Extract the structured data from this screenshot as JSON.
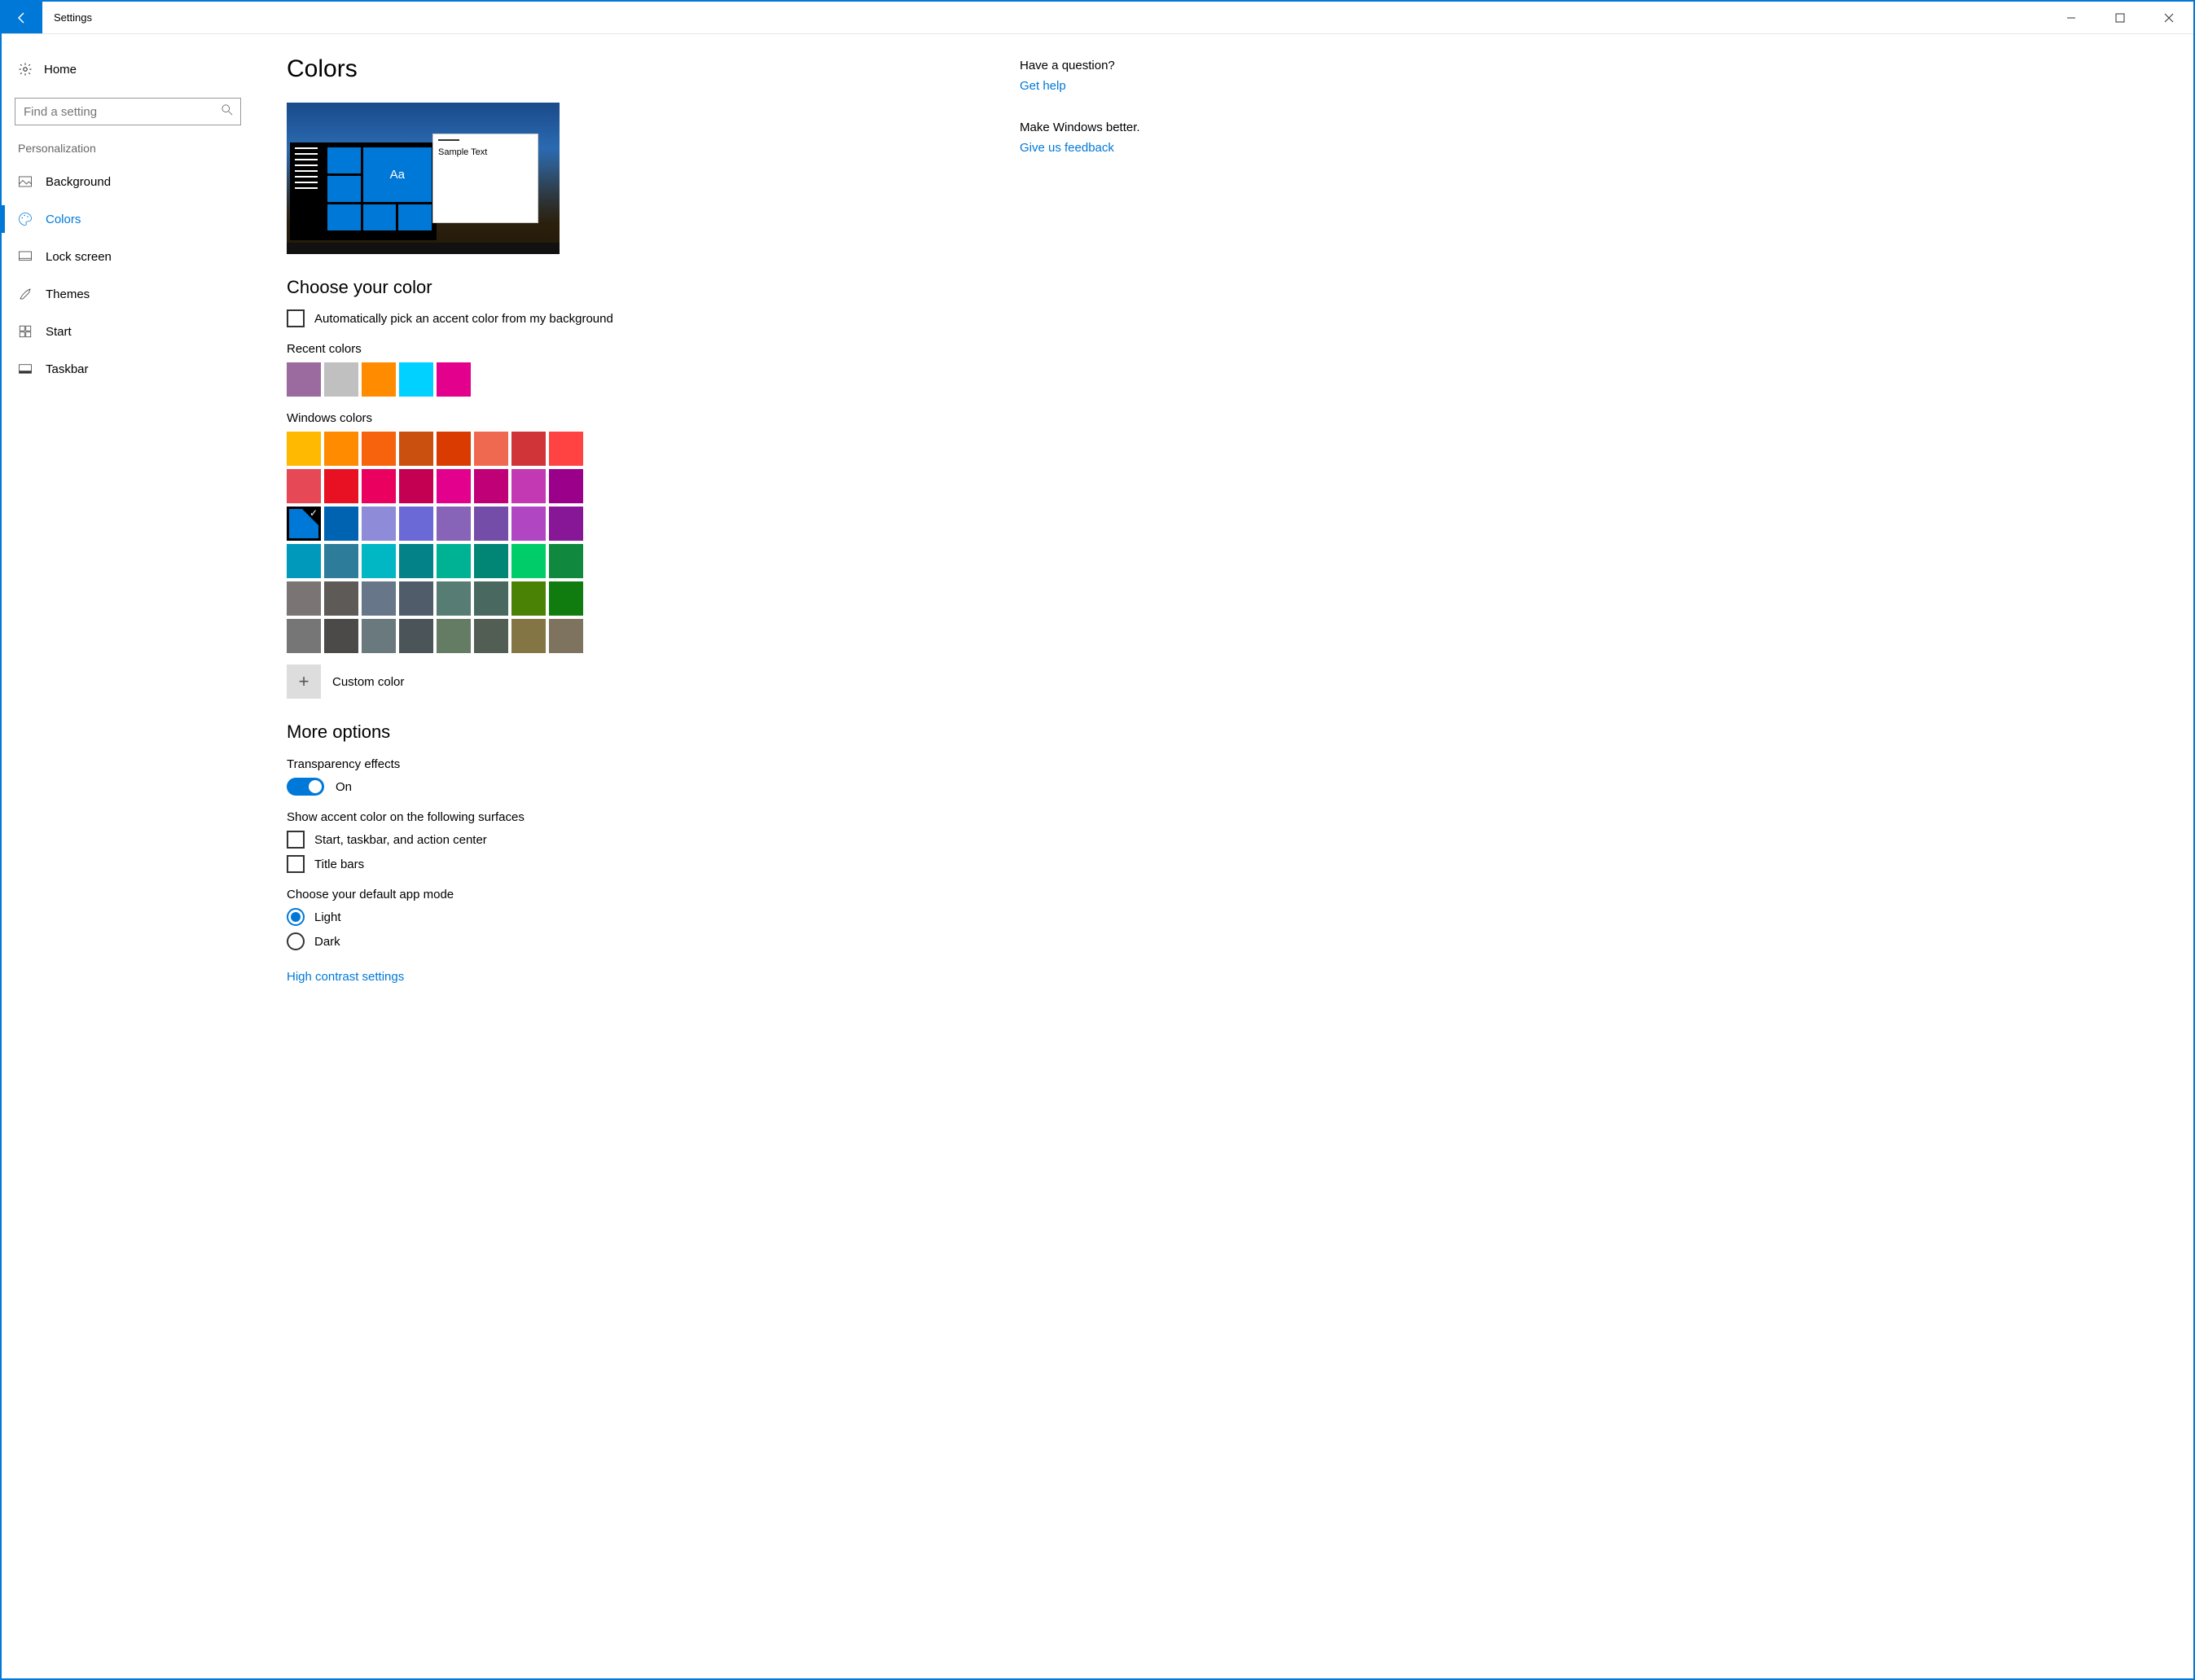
{
  "accent": "#0078d7",
  "titlebar": {
    "title": "Settings"
  },
  "sidebar": {
    "home": "Home",
    "search_placeholder": "Find a setting",
    "section": "Personalization",
    "items": [
      {
        "label": "Background"
      },
      {
        "label": "Colors"
      },
      {
        "label": "Lock screen"
      },
      {
        "label": "Themes"
      },
      {
        "label": "Start"
      },
      {
        "label": "Taskbar"
      }
    ]
  },
  "page": {
    "title": "Colors",
    "preview_tile_text": "Aa",
    "preview_window_text": "Sample Text",
    "choose_heading": "Choose your color",
    "auto_accent_label": "Automatically pick an accent color from my background",
    "recent_label": "Recent colors",
    "recent_colors": [
      "#9b6a9e",
      "#c0c0c0",
      "#ff8c00",
      "#00d1ff",
      "#e3008c"
    ],
    "windows_colors_label": "Windows colors",
    "windows_colors": [
      "#ffb900",
      "#ff8c00",
      "#f7630c",
      "#ca5010",
      "#da3b01",
      "#ef6950",
      "#d13438",
      "#ff4343",
      "#e74856",
      "#e81123",
      "#ea005e",
      "#c30052",
      "#e3008c",
      "#bf0077",
      "#c239b3",
      "#9a0089",
      "#0078d7",
      "#0063b1",
      "#8e8cd8",
      "#6b69d6",
      "#8764b8",
      "#744da9",
      "#b146c2",
      "#881798",
      "#0099bc",
      "#2d7d9a",
      "#00b7c3",
      "#038387",
      "#00b294",
      "#018574",
      "#00cc6a",
      "#10893e",
      "#7a7574",
      "#5d5a58",
      "#68768a",
      "#515c6b",
      "#567c73",
      "#486860",
      "#498205",
      "#107c10",
      "#767676",
      "#4c4a48",
      "#69797e",
      "#4a5459",
      "#647c64",
      "#525e54",
      "#847545",
      "#7e735f"
    ],
    "selected_color_index": 16,
    "custom_label": "Custom color",
    "more_heading": "More options",
    "transparency_label": "Transparency effects",
    "transparency_value": "On",
    "surfaces_label": "Show accent color on the following surfaces",
    "surface_start_label": "Start, taskbar, and action center",
    "surface_title_label": "Title bars",
    "mode_label": "Choose your default app mode",
    "mode_light": "Light",
    "mode_dark": "Dark",
    "high_contrast_link": "High contrast settings"
  },
  "aside": {
    "q_heading": "Have a question?",
    "q_link": "Get help",
    "fb_heading": "Make Windows better.",
    "fb_link": "Give us feedback"
  }
}
